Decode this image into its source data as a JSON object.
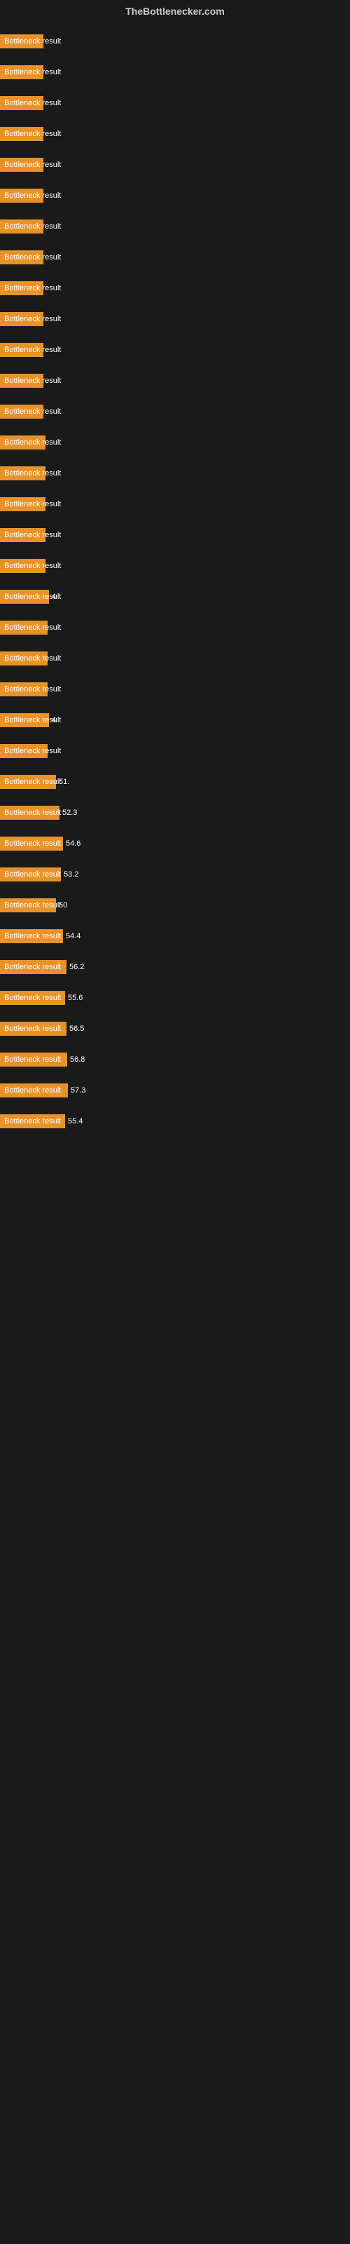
{
  "header": {
    "title": "TheBottlenecker.com"
  },
  "bars": [
    {
      "label": "Bottleneck result",
      "value": "",
      "width": 62
    },
    {
      "label": "Bottleneck result",
      "value": "",
      "width": 62
    },
    {
      "label": "Bottleneck result",
      "value": "",
      "width": 62
    },
    {
      "label": "Bottleneck result",
      "value": "",
      "width": 62
    },
    {
      "label": "Bottleneck result",
      "value": "",
      "width": 62
    },
    {
      "label": "Bottleneck result",
      "value": "",
      "width": 62
    },
    {
      "label": "Bottleneck result",
      "value": "",
      "width": 62
    },
    {
      "label": "Bottleneck result",
      "value": "",
      "width": 62
    },
    {
      "label": "Bottleneck result",
      "value": "",
      "width": 62
    },
    {
      "label": "Bottleneck result",
      "value": "",
      "width": 62
    },
    {
      "label": "Bottleneck result",
      "value": "",
      "width": 62
    },
    {
      "label": "Bottleneck result",
      "value": "",
      "width": 62
    },
    {
      "label": "Bottleneck result",
      "value": "",
      "width": 62
    },
    {
      "label": "Bottleneck result",
      "value": "",
      "width": 65
    },
    {
      "label": "Bottleneck result",
      "value": "",
      "width": 65
    },
    {
      "label": "Bottleneck result",
      "value": "",
      "width": 65
    },
    {
      "label": "Bottleneck result",
      "value": "",
      "width": 65
    },
    {
      "label": "Bottleneck result",
      "value": "",
      "width": 65
    },
    {
      "label": "Bottleneck result",
      "value": "4",
      "width": 70
    },
    {
      "label": "Bottleneck result",
      "value": "",
      "width": 68
    },
    {
      "label": "Bottleneck result",
      "value": "",
      "width": 68
    },
    {
      "label": "Bottleneck result",
      "value": "",
      "width": 68
    },
    {
      "label": "Bottleneck result",
      "value": "4",
      "width": 70
    },
    {
      "label": "Bottleneck result",
      "value": "",
      "width": 68
    },
    {
      "label": "Bottleneck result",
      "value": "51.",
      "width": 80
    },
    {
      "label": "Bottleneck result",
      "value": "52.3",
      "width": 85
    },
    {
      "label": "Bottleneck result",
      "value": "54.6",
      "width": 90
    },
    {
      "label": "Bottleneck result",
      "value": "53.2",
      "width": 87
    },
    {
      "label": "Bottleneck result",
      "value": "50",
      "width": 80
    },
    {
      "label": "Bottleneck result",
      "value": "54.4",
      "width": 90
    },
    {
      "label": "Bottleneck result",
      "value": "56.2",
      "width": 95
    },
    {
      "label": "Bottleneck result",
      "value": "55.6",
      "width": 93
    },
    {
      "label": "Bottleneck result",
      "value": "56.5",
      "width": 95
    },
    {
      "label": "Bottleneck result",
      "value": "56.8",
      "width": 96
    },
    {
      "label": "Bottleneck result",
      "value": "57.3",
      "width": 97
    },
    {
      "label": "Bottleneck result",
      "value": "55.4",
      "width": 93
    }
  ]
}
